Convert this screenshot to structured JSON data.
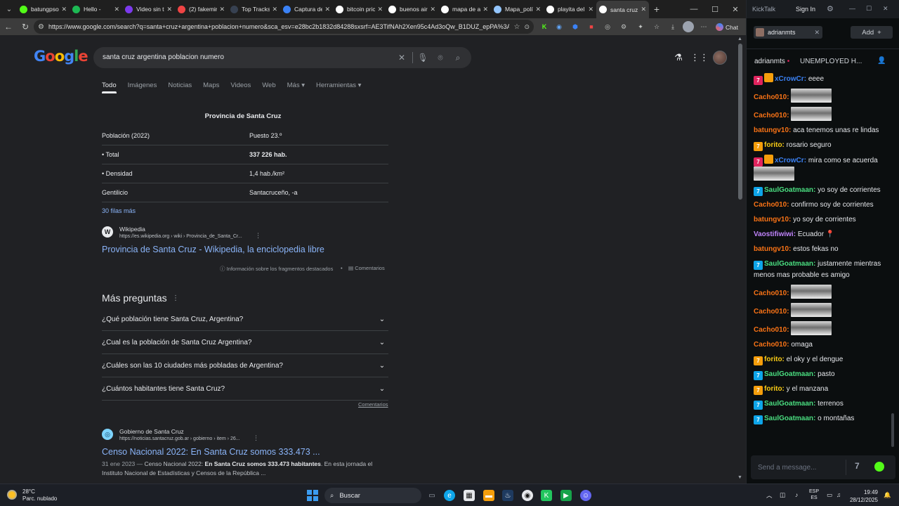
{
  "browser": {
    "tabs": [
      {
        "label": "batungpso",
        "color": "#53fc18"
      },
      {
        "label": "Hello -",
        "color": "#1db954"
      },
      {
        "label": "Video sin tít",
        "color": "#7c3aed"
      },
      {
        "label": "(2) fakemin",
        "color": "#ef4444"
      },
      {
        "label": "Top Tracks",
        "color": "#374151"
      },
      {
        "label": "Captura de",
        "color": "#3b82f6"
      },
      {
        "label": "bitcoin pric",
        "color": "#ffffff"
      },
      {
        "label": "buenos aire",
        "color": "#ffffff"
      },
      {
        "label": "mapa de ar",
        "color": "#ffffff"
      },
      {
        "label": "Mapa_polít",
        "color": "#93c5fd"
      },
      {
        "label": "playita del",
        "color": "#ffffff"
      },
      {
        "label": "santa cruz",
        "color": "#ffffff"
      }
    ],
    "url": "https://www.google.com/search?q=santa+cruz+argentina+poblacion+numero&sca_esv=e28bc2b1832d84288sxsrf=AE3TifNAh2Xen95c4Ad3oQw_B1DUZ_epPA%3A176...",
    "chat_label": "Chat"
  },
  "google": {
    "query": "santa cruz argentina poblacion numero",
    "tabs": [
      "Todo",
      "Imágenes",
      "Noticias",
      "Maps",
      "Videos",
      "Web",
      "Más ▾",
      "Herramientas ▾"
    ],
    "panel": {
      "title": "Provincia de Santa Cruz",
      "rows": [
        {
          "key": "Población (2022)",
          "value": "Puesto 23.º"
        },
        {
          "key": "• Total",
          "value": "337 226 hab."
        },
        {
          "key": "• Densidad",
          "value": "1,4 hab./km²"
        },
        {
          "key": "Gentilicio",
          "value": "Santacruceño, -a"
        }
      ],
      "more_rows": "30 filas más"
    },
    "result1": {
      "site": "Wikipedia",
      "breadcrumb": "https://es.wikipedia.org › wiki › Provincia_de_Santa_Cr...",
      "title": "Provincia de Santa Cruz - Wikipedia, la enciclopedia libre",
      "favicon": "W"
    },
    "about_snippets": "Información sobre los fragmentos destacados",
    "feedback": "Comentarios",
    "more_questions": {
      "title": "Más preguntas",
      "items": [
        "¿Qué población tiene Santa Cruz, Argentina?",
        "¿Cual es la población de Santa Cruz Argentina?",
        "¿Cuáles son las 10 ciudades más pobladas de Argentina?",
        "¿Cuántos habitantes tiene Santa Cruz?"
      ],
      "feedback": "Comentarios"
    },
    "result2": {
      "site": "Gobierno de Santa Cruz",
      "breadcrumb": "https://noticias.santacruz.gob.ar › gobierno › item › 26...",
      "title": "Censo Nacional 2022: En Santa Cruz somos 333.473 ...",
      "date": "31 ene 2023 —",
      "snippet_a": "Censo Nacional 2022:",
      "snippet_b": "En Santa Cruz somos 333.473 habitantes",
      "snippet_c": ". En esta jornada el Instituto Nacional de Estadísticas y Censos de la República ..."
    }
  },
  "kick": {
    "title": "KickTalk",
    "sign_in": "Sign In",
    "channel_tab": "adrianmts",
    "add_label": "Add",
    "streamer": "adrianmts",
    "stream_title": "UNEMPLOYED H...",
    "messages": [
      {
        "user": "xCrowCr",
        "color": "#3b82f6",
        "badges": [
          "#e0245e",
          "#f59e0b"
        ],
        "text": "eeee"
      },
      {
        "user": "Cacho010",
        "color": "#f97316",
        "emote": true
      },
      {
        "user": "Cacho010",
        "color": "#f97316",
        "emote": true
      },
      {
        "user": "batungv10",
        "color": "#f97316",
        "text": "aca tenemos unas re lindas"
      },
      {
        "user": "forito",
        "color": "#facc15",
        "badges": [
          "#f59e0b"
        ],
        "text": "rosario seguro"
      },
      {
        "user": "xCrowCr",
        "color": "#3b82f6",
        "badges": [
          "#e0245e",
          "#f59e0b"
        ],
        "text": "mira como se acuerda",
        "emote": true
      },
      {
        "user": "SaulGoatmaan",
        "color": "#4ade80",
        "badges": [
          "#0ea5e9"
        ],
        "text": "yo soy de corrientes"
      },
      {
        "user": "Cacho010",
        "color": "#f97316",
        "text": "confirmo soy de corrientes"
      },
      {
        "user": "batungv10",
        "color": "#f97316",
        "text": "yo soy de corrientes"
      },
      {
        "user": "Vaostifiwiwi",
        "color": "#c084fc",
        "text": "Ecuador 📍"
      },
      {
        "user": "batungv10",
        "color": "#f97316",
        "text": "estos fekas no"
      },
      {
        "user": "SaulGoatmaan",
        "color": "#4ade80",
        "badges": [
          "#0ea5e9"
        ],
        "text": "justamente mientras menos mas probable es amigo"
      },
      {
        "user": "Cacho010",
        "color": "#f97316",
        "emote": true
      },
      {
        "user": "Cacho010",
        "color": "#f97316",
        "emote": true
      },
      {
        "user": "Cacho010",
        "color": "#f97316",
        "emote": true
      },
      {
        "user": "Cacho010",
        "color": "#f97316",
        "text": "omaga"
      },
      {
        "user": "forito",
        "color": "#facc15",
        "badges": [
          "#f59e0b"
        ],
        "text": "el oky y el dengue"
      },
      {
        "user": "SaulGoatmaan",
        "color": "#4ade80",
        "badges": [
          "#0ea5e9"
        ],
        "text": "pasto"
      },
      {
        "user": "forito",
        "color": "#facc15",
        "badges": [
          "#f59e0b"
        ],
        "text": "y el manzana"
      },
      {
        "user": "SaulGoatmaan",
        "color": "#4ade80",
        "badges": [
          "#0ea5e9"
        ],
        "text": "terrenos"
      },
      {
        "user": "SaulGoatmaan",
        "color": "#4ade80",
        "badges": [
          "#0ea5e9"
        ],
        "text": "o montañas"
      }
    ],
    "input_placeholder": "Send a message..."
  },
  "taskbar": {
    "temp": "28°C",
    "weather": "Parc. nublado",
    "search": "Buscar",
    "lang_top": "ESP",
    "lang_bottom": "ES",
    "time": "19:49",
    "date": "28/12/2025"
  }
}
